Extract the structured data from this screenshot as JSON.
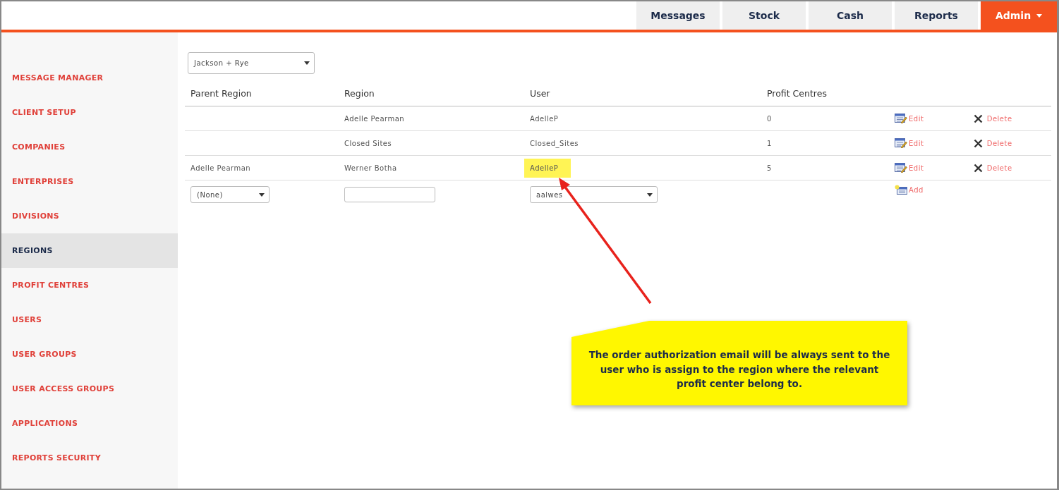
{
  "top_nav": [
    {
      "label": "Messages",
      "selected": false
    },
    {
      "label": "Stock",
      "selected": false
    },
    {
      "label": "Cash",
      "selected": false
    },
    {
      "label": "Reports",
      "selected": false
    },
    {
      "label": "Admin",
      "selected": true
    }
  ],
  "sidebar": {
    "items": [
      {
        "label": "MESSAGE MANAGER",
        "selected": false
      },
      {
        "label": "CLIENT SETUP",
        "selected": false
      },
      {
        "label": "COMPANIES",
        "selected": false
      },
      {
        "label": "ENTERPRISES",
        "selected": false
      },
      {
        "label": "DIVISIONS",
        "selected": false
      },
      {
        "label": "REGIONS",
        "selected": true
      },
      {
        "label": "PROFIT CENTRES",
        "selected": false
      },
      {
        "label": "USERS",
        "selected": false
      },
      {
        "label": "USER GROUPS",
        "selected": false
      },
      {
        "label": "USER ACCESS GROUPS",
        "selected": false
      },
      {
        "label": "APPLICATIONS",
        "selected": false
      },
      {
        "label": "REPORTS SECURITY",
        "selected": false
      }
    ]
  },
  "client_select": {
    "value": "Jackson + Rye"
  },
  "table": {
    "columns": [
      "Parent Region",
      "Region",
      "User",
      "Profit Centres"
    ],
    "rows": [
      {
        "parent_region": "",
        "region": "Adelle Pearman",
        "user": "AdelleP",
        "highlighted": false,
        "profit_centres": "0",
        "edit": "Edit",
        "delete": "Delete"
      },
      {
        "parent_region": "",
        "region": "Closed Sites",
        "user": "Closed_Sites",
        "highlighted": false,
        "profit_centres": "1",
        "edit": "Edit",
        "delete": "Delete"
      },
      {
        "parent_region": "Adelle Pearman",
        "region": "Werner Botha",
        "user": "AdelleP",
        "highlighted": true,
        "profit_centres": "5",
        "edit": "Edit",
        "delete": "Delete"
      }
    ],
    "new_row": {
      "parent_region": "(None)",
      "user": "aalwes",
      "add": "Add"
    }
  },
  "callout": {
    "text": "The order authorization email will be always sent to the user who is assign to the region where the relevant profit center belong to."
  }
}
